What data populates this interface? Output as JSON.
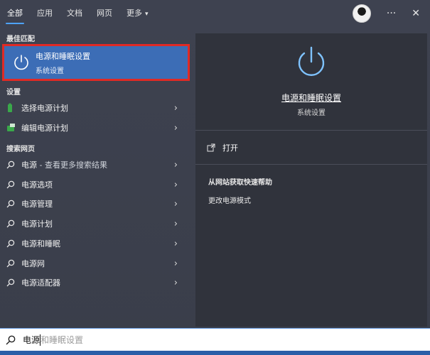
{
  "tabs": [
    {
      "label": "全部"
    },
    {
      "label": "应用"
    },
    {
      "label": "文档"
    },
    {
      "label": "网页"
    },
    {
      "label": "更多",
      "caret": "▾"
    }
  ],
  "top_right": {
    "more": "···",
    "close": "✕"
  },
  "left": {
    "best_match_label": "最佳匹配",
    "best_match": {
      "title": "电源和睡眠设置",
      "subtitle": "系统设置"
    },
    "settings_label": "设置",
    "settings_items": [
      {
        "label": "选择电源计划"
      },
      {
        "label": "编辑电源计划"
      }
    ],
    "web_label": "搜索网页",
    "web_items": [
      {
        "bold": "电源",
        "rest": " - 查看更多搜索结果"
      },
      {
        "bold": "电源",
        "rest": "选项"
      },
      {
        "bold": "电源",
        "rest": "管理"
      },
      {
        "bold": "电源",
        "rest": "计划"
      },
      {
        "bold": "电源",
        "rest": "和睡眠"
      },
      {
        "bold": "电源",
        "rest": "网"
      },
      {
        "bold": "电源",
        "rest": "适配器"
      }
    ],
    "chevron": "›"
  },
  "right": {
    "title": "电源和睡眠设置",
    "subtitle": "系统设置",
    "open_label": "打开",
    "help_title": "从网站获取快速帮助",
    "help_link": "更改电源模式"
  },
  "search": {
    "typed": "电源",
    "hint": "和睡眠设置"
  },
  "colors": {
    "accent": "#4ea3ff",
    "highlight": "#3c6db6",
    "outline": "#e02a25"
  }
}
